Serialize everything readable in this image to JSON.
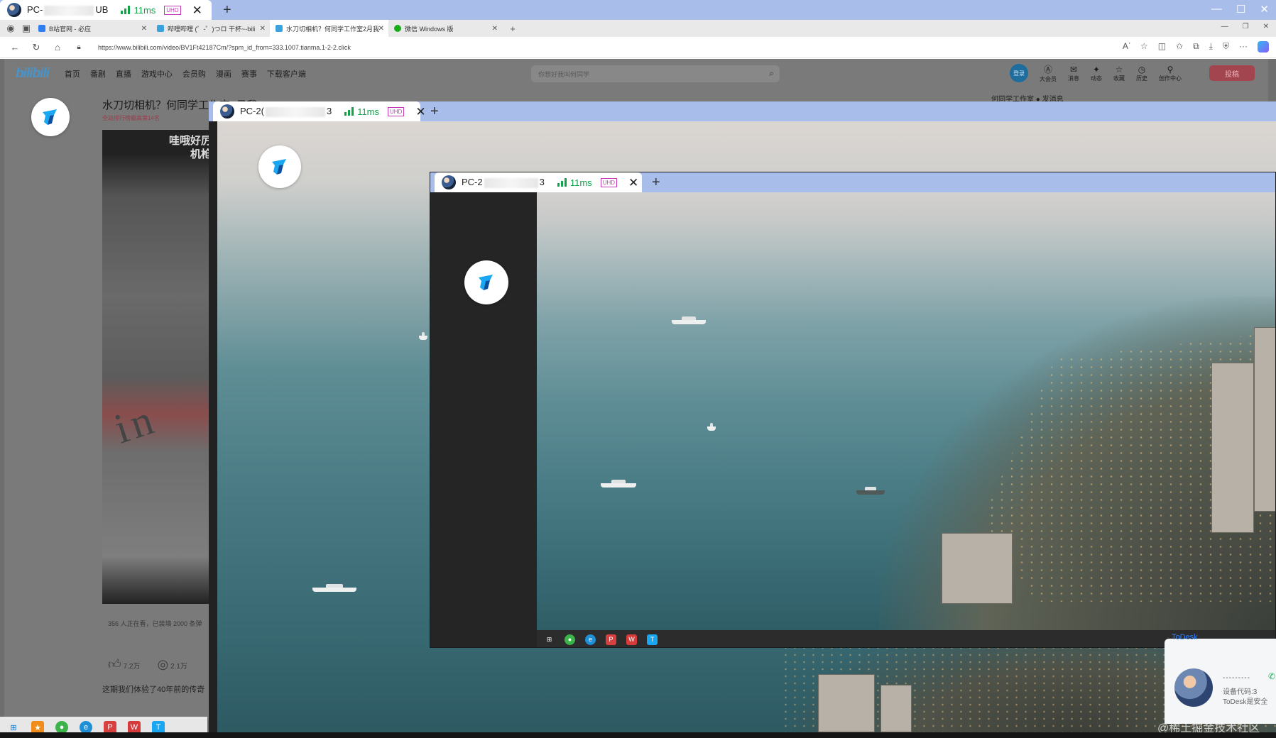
{
  "outer_window": {
    "tab_name_prefix": "PC-",
    "tab_name_suffix": "UB",
    "latency": "11ms",
    "quality_badge": "UHD",
    "close": "✕",
    "new_tab": "+",
    "controls": [
      "—",
      "☐",
      "✕"
    ]
  },
  "browser": {
    "tabs": [
      {
        "title": "B站官网 - 必应",
        "color": "#2f7df6"
      },
      {
        "title": "哔哩哔哩 (゜-゜)つロ 干杯~-bili",
        "color": "#3aa3de"
      },
      {
        "title": "水刀切相机？何同学工作室2月我",
        "color": "#3aa3de"
      },
      {
        "title": "微信 Windows 版",
        "color": "#1aad19"
      }
    ],
    "url": "https://www.bilibili.com/video/BV1Ft42187Cm/?spm_id_from=333.1007.tianma.1-2-2.click"
  },
  "bilibili": {
    "logo": "bilibili",
    "nav": [
      "首页",
      "番剧",
      "直播",
      "游戏中心",
      "会员购",
      "漫画",
      "赛事",
      "下载客户端"
    ],
    "search_placeholder": "你想好我叫何同学",
    "login": "登录",
    "right_items": [
      {
        "icon": "Ⓐ",
        "label": "大会员"
      },
      {
        "icon": "✉",
        "label": "消息"
      },
      {
        "icon": "✦",
        "label": "动态"
      },
      {
        "icon": "☆",
        "label": "收藏"
      },
      {
        "icon": "◷",
        "label": "历史"
      },
      {
        "icon": "⚲",
        "label": "创作中心"
      }
    ],
    "upload": "投稿",
    "uploader": "何同学工作室  ● 发消息",
    "video_title": "水刀切相机？何同学工作室2月我",
    "rank": "全站排行榜最高第14名",
    "video_caption_line1": "哇哦好厉",
    "video_caption_line2": "机枪",
    "video_letters": "in",
    "stats": "356 人正在看，已装填 2000 条弹",
    "likes": "7.2万",
    "coins": "2.1万",
    "description": "这期我们体验了40年前的传奇"
  },
  "nested": {
    "tab2_prefix": "PC-2(",
    "tab2_suffix": "3",
    "tab3_prefix": "PC-2",
    "tab3_suffix": "3",
    "latency": "11ms",
    "quality_badge": "UHD"
  },
  "todesk_popup": {
    "brand": "ToDesk",
    "dashes": "---------",
    "device_code": "设备代码:3",
    "safety": "ToDesk是安全",
    "call_icon": "✆"
  },
  "watermark": "@稀土掘金技术社区",
  "taskbar_icons": [
    "windows-icon",
    "star-icon",
    "wechat-icon",
    "edge-icon",
    "p-icon",
    "wps-icon",
    "todesk-icon"
  ]
}
